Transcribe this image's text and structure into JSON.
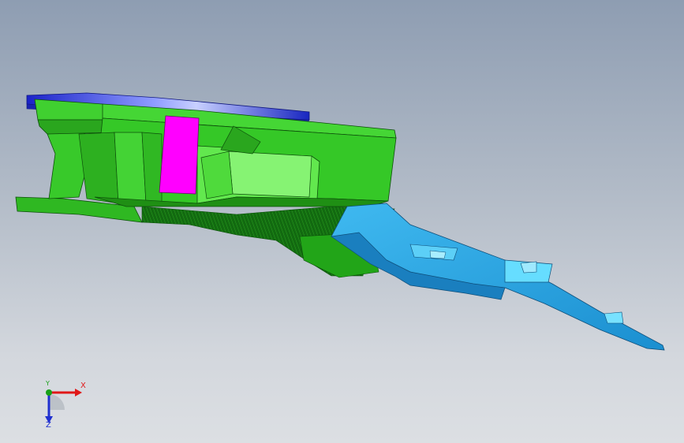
{
  "viewport": {
    "background_top": "#8e9db2",
    "background_bottom": "#dcdfe3"
  },
  "model": {
    "colors": {
      "green_part": "#33cc22",
      "green_light": "#7ef06a",
      "green_dark": "#1f8f14",
      "blue_cover": "#1f2fd8",
      "blue_highlight": "#a9b4ff",
      "magenta_block": "#ff00ff",
      "cyan_part": "#33bbee",
      "cyan_light": "#66ddff",
      "cyan_dark": "#1e88c4"
    }
  },
  "triad": {
    "x_label": "X",
    "y_label": "Y",
    "z_label": "Z",
    "x_color": "#e01818",
    "y_color": "#18a018",
    "z_color": "#2030d0"
  }
}
